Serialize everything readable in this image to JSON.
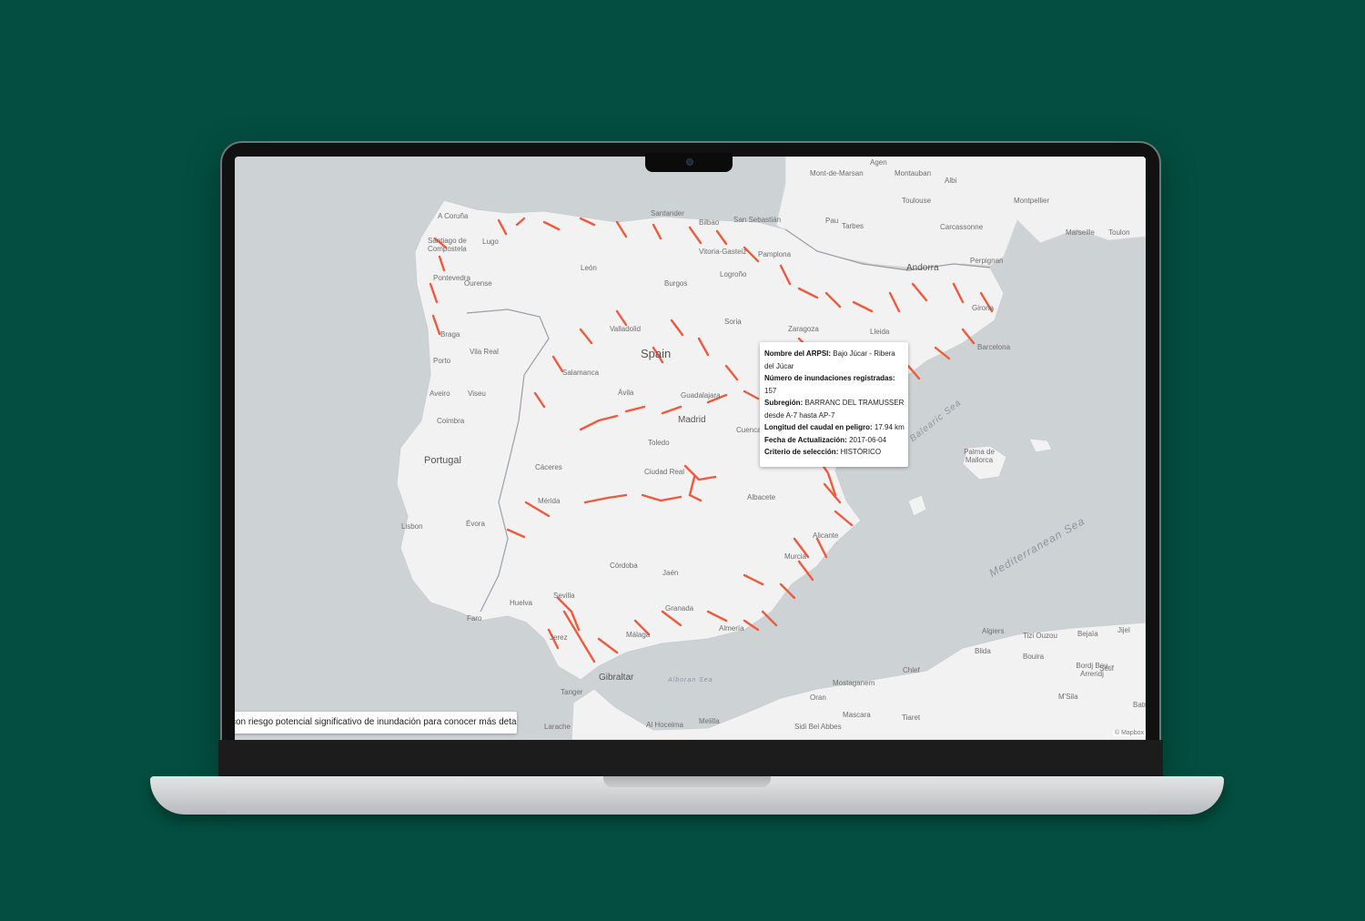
{
  "map": {
    "countries": [
      "Spain",
      "Portugal",
      "Andorra"
    ],
    "seas": [
      "Balearic Sea",
      "Mediterranean Sea",
      "Alboran Sea"
    ],
    "places": [
      "Agen",
      "Mont-de-Marsan",
      "Montauban",
      "Albi",
      "Toulouse",
      "Montpellier",
      "Pau",
      "Tarbes",
      "Carcassonne",
      "Marseille",
      "Toulon",
      "Perpignan",
      "San Sebastián",
      "Santander",
      "Bilbao",
      "Vitoria-Gasteiz",
      "Pamplona",
      "Logroño",
      "Burgos",
      "León",
      "A Coruña",
      "Santiago de Compostela",
      "Lugo",
      "Pontevedra",
      "Ourense",
      "Braga",
      "Vila Real",
      "Porto",
      "Aveiro",
      "Viseu",
      "Coimbra",
      "Valladolid",
      "Soria",
      "Zaragoza",
      "Lleida",
      "Girona",
      "Barcelona",
      "Salamanca",
      "Ávila",
      "Guadalajara",
      "Madrid",
      "Cuenca",
      "Toledo",
      "Cáceres",
      "Ciudad Real",
      "Albacete",
      "Mérida",
      "Lisbon",
      "Évora",
      "Córdoba",
      "Jaén",
      "Sevilla",
      "Huelva",
      "Faro",
      "Granada",
      "Almería",
      "Málaga",
      "Jerez",
      "Gibraltar",
      "Tanger",
      "Larache",
      "Al Hoceima",
      "Melilla",
      "Alicante",
      "Murcia",
      "Palma de Mallorca",
      "Algiers",
      "Tizi Ouzou",
      "Bejaïa",
      "Jijel",
      "Blida",
      "Chlef",
      "Bouira",
      "Bordj Bou Arreridj",
      "Sétif",
      "Mostaganem",
      "Oran",
      "Sidi Bel Abbes",
      "Mascara",
      "Tiaret",
      "M'Sila",
      "Batna"
    ]
  },
  "tooltip": {
    "arpsi_label": "Nombre del ARPSI:",
    "arpsi_value": "Bajo Júcar - Ribera del Júcar",
    "floods_label": "Número de inundaciones registradas:",
    "floods_value": "157",
    "subregion_label": "Subregión:",
    "subregion_value": "BARRANC DEL TRAMUSSER desde A-7 hasta AP-7",
    "length_label": "Longitud del caudal en peligro:",
    "length_value": "17.94 km",
    "updated_label": "Fecha de Actualización:",
    "updated_value": "2017-06-04",
    "criteria_label": "Criterio de selección:",
    "criteria_value": "HISTÓRICO"
  },
  "info_bar": {
    "text": "con riesgo potencial significativo de inundación para conocer más detalles"
  },
  "attribution": "© Mapbox",
  "colors": {
    "background": "#034e40",
    "sea": "#cdd3d5",
    "land": "#f2f2f2",
    "flood_risk": "#f05a3c"
  }
}
